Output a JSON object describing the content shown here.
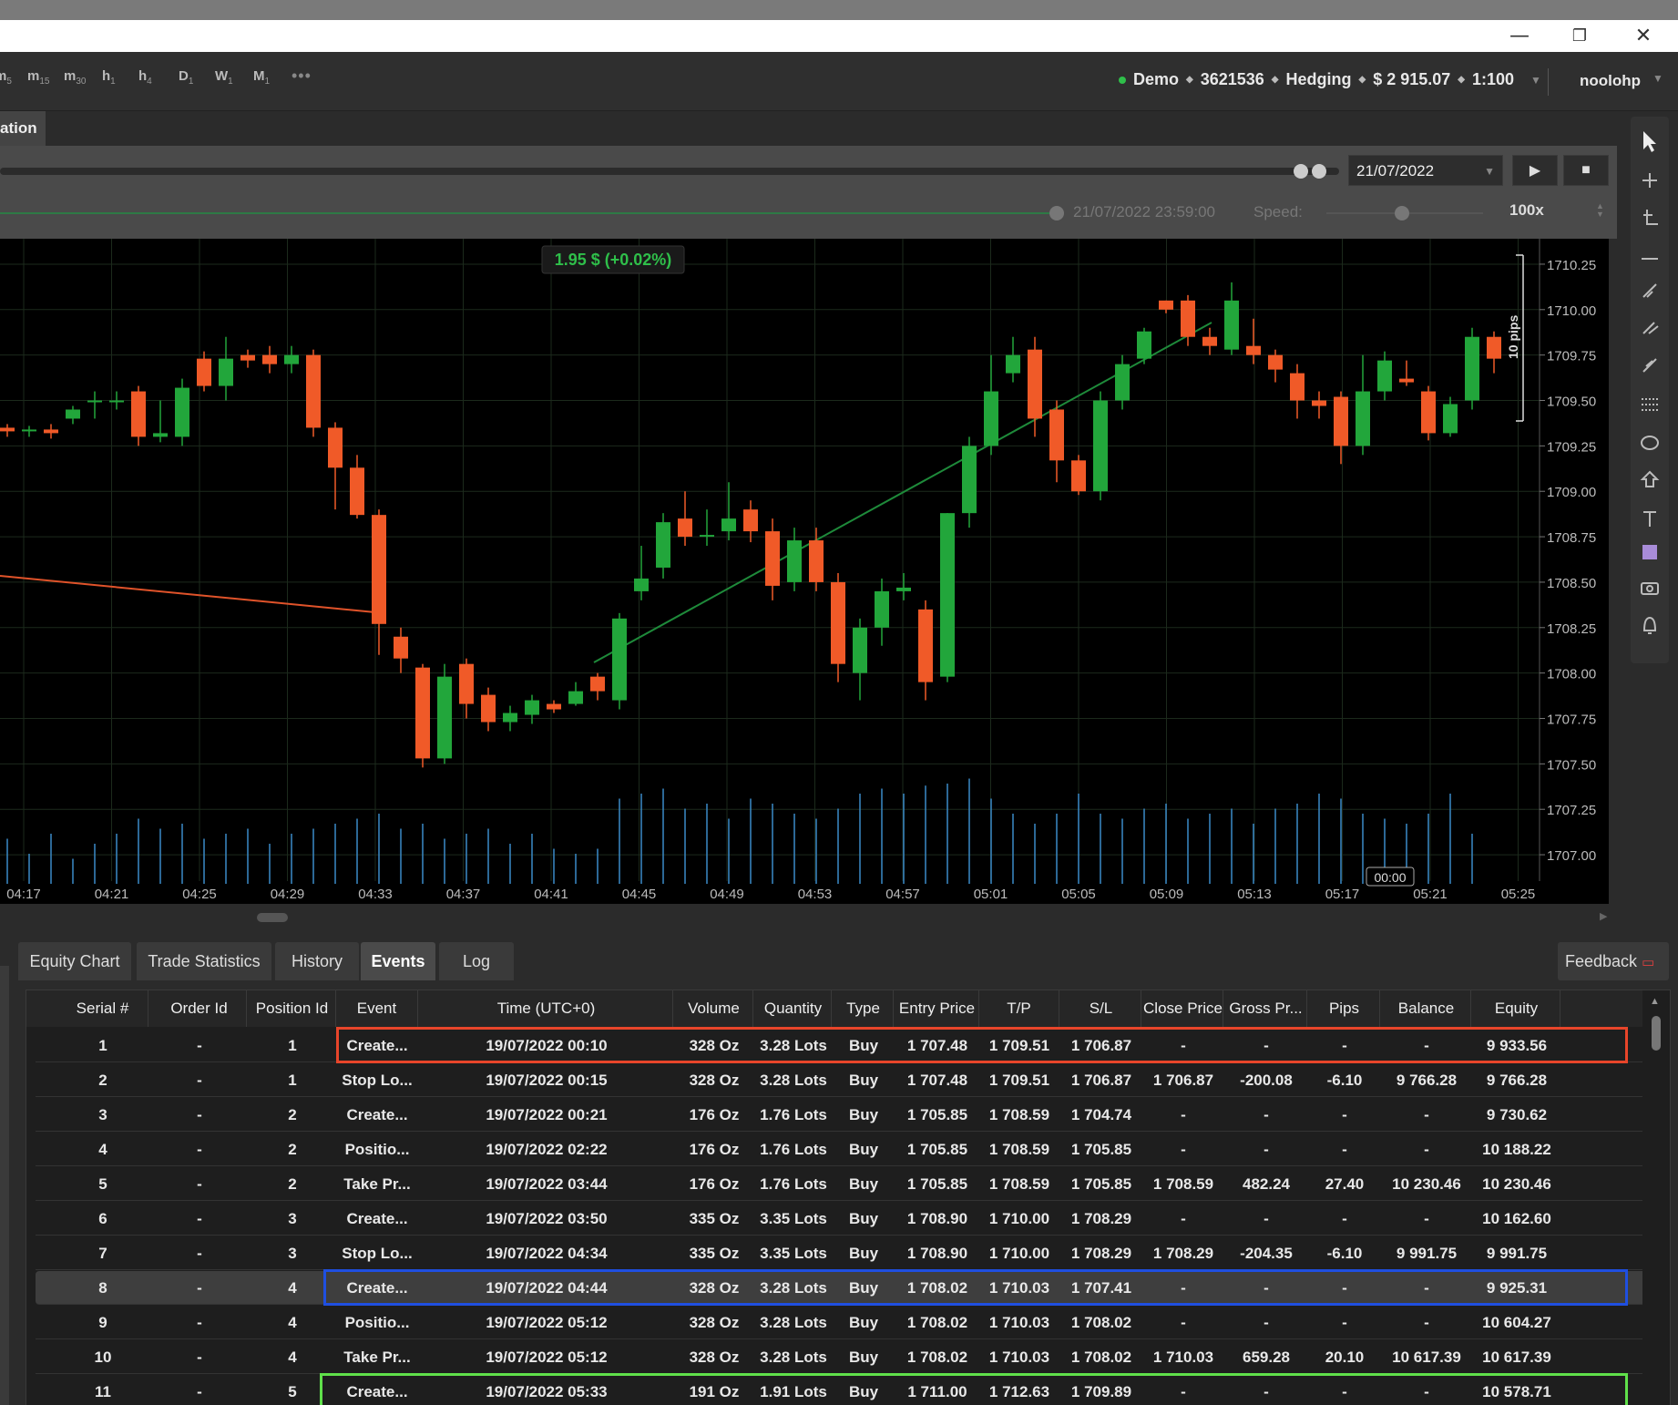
{
  "window": {
    "minimize": "—",
    "restore": "❐",
    "close": "✕"
  },
  "toolbar": {
    "timeframes": [
      {
        "main": "m",
        "sub": "5"
      },
      {
        "main": "m",
        "sub": "15"
      },
      {
        "main": "m",
        "sub": "30"
      },
      {
        "main": "h",
        "sub": "1"
      },
      {
        "main": "h",
        "sub": "4"
      },
      {
        "main": "D",
        "sub": "1"
      },
      {
        "main": "W",
        "sub": "1"
      },
      {
        "main": "M",
        "sub": "1"
      }
    ],
    "more": "•••",
    "account": {
      "mode": "Demo",
      "number": "3621536",
      "type": "Hedging",
      "balance": "$ 2 915.07",
      "leverage": "1:100"
    },
    "user": "noolohp"
  },
  "tab": {
    "label": "ation"
  },
  "controls": {
    "date": "21/07/2022",
    "end_date": "21/07/2022 23:59:00",
    "speed_label": "Speed:",
    "speed_value": "100x",
    "play": "▶",
    "stop": "■"
  },
  "chart_data": {
    "type": "candlestick",
    "pnl_label": "1.95 $ (+0.02%)",
    "measure_label": "10 pips",
    "time_marker": "00:00",
    "y_ticks": [
      "1710.25",
      "1710.00",
      "1709.75",
      "1709.50",
      "1709.25",
      "1709.00",
      "1708.75",
      "1708.50",
      "1708.25",
      "1708.00",
      "1707.75",
      "1707.50",
      "1707.25",
      "1707.00"
    ],
    "x_ticks": [
      "04:17",
      "04:21",
      "04:25",
      "04:29",
      "04:33",
      "04:37",
      "04:41",
      "04:45",
      "04:49",
      "04:53",
      "04:57",
      "05:01",
      "05:05",
      "05:09",
      "05:13",
      "05:17",
      "05:21",
      "05:25"
    ],
    "ylim": [
      1706.88,
      1710.35
    ],
    "up_color": "#22a63b",
    "down_color": "#f05a28",
    "candles": [
      [
        1709.35,
        1709.33,
        1709.3,
        1709.37
      ],
      [
        1709.33,
        1709.34,
        1709.3,
        1709.36
      ],
      [
        1709.34,
        1709.32,
        1709.29,
        1709.37
      ],
      [
        1709.4,
        1709.45,
        1709.37,
        1709.47
      ],
      [
        1709.5,
        1709.5,
        1709.4,
        1709.55
      ],
      [
        1709.5,
        1709.5,
        1709.45,
        1709.55
      ],
      [
        1709.55,
        1709.3,
        1709.25,
        1709.58
      ],
      [
        1709.3,
        1709.32,
        1709.27,
        1709.5
      ],
      [
        1709.3,
        1709.57,
        1709.25,
        1709.62
      ],
      [
        1709.73,
        1709.58,
        1709.55,
        1709.77
      ],
      [
        1709.58,
        1709.73,
        1709.5,
        1709.85
      ],
      [
        1709.75,
        1709.72,
        1709.68,
        1709.78
      ],
      [
        1709.75,
        1709.7,
        1709.65,
        1709.8
      ],
      [
        1709.7,
        1709.75,
        1709.65,
        1709.8
      ],
      [
        1709.75,
        1709.35,
        1709.3,
        1709.78
      ],
      [
        1709.35,
        1709.13,
        1708.9,
        1709.38
      ],
      [
        1709.13,
        1708.87,
        1708.85,
        1709.2
      ],
      [
        1708.87,
        1708.27,
        1708.1,
        1708.9
      ],
      [
        1708.2,
        1708.08,
        1708.0,
        1708.25
      ],
      [
        1708.03,
        1707.53,
        1707.48,
        1708.05
      ],
      [
        1707.53,
        1707.98,
        1707.5,
        1708.05
      ],
      [
        1708.05,
        1707.83,
        1707.75,
        1708.08
      ],
      [
        1707.88,
        1707.73,
        1707.68,
        1707.92
      ],
      [
        1707.73,
        1707.78,
        1707.68,
        1707.82
      ],
      [
        1707.77,
        1707.85,
        1707.72,
        1707.88
      ],
      [
        1707.83,
        1707.8,
        1707.78,
        1707.85
      ],
      [
        1707.83,
        1707.9,
        1707.82,
        1707.95
      ],
      [
        1707.98,
        1707.9,
        1707.85,
        1708.0
      ],
      [
        1707.85,
        1708.3,
        1707.8,
        1708.33
      ],
      [
        1708.45,
        1708.52,
        1708.4,
        1708.7
      ],
      [
        1708.58,
        1708.83,
        1708.52,
        1708.88
      ],
      [
        1708.85,
        1708.75,
        1708.7,
        1709.0
      ],
      [
        1708.75,
        1708.76,
        1708.7,
        1708.9
      ],
      [
        1708.78,
        1708.85,
        1708.73,
        1709.05
      ],
      [
        1708.9,
        1708.78,
        1708.72,
        1708.95
      ],
      [
        1708.78,
        1708.48,
        1708.4,
        1708.85
      ],
      [
        1708.5,
        1708.73,
        1708.45,
        1708.8
      ],
      [
        1708.73,
        1708.5,
        1708.45,
        1708.8
      ],
      [
        1708.5,
        1708.05,
        1707.95,
        1708.55
      ],
      [
        1708.0,
        1708.25,
        1707.85,
        1708.3
      ],
      [
        1708.25,
        1708.45,
        1708.15,
        1708.52
      ],
      [
        1708.45,
        1708.47,
        1708.4,
        1708.55
      ],
      [
        1708.35,
        1707.95,
        1707.85,
        1708.4
      ],
      [
        1707.98,
        1708.88,
        1707.95,
        1708.88
      ],
      [
        1708.88,
        1709.25,
        1708.8,
        1709.3
      ],
      [
        1709.25,
        1709.55,
        1709.2,
        1709.75
      ],
      [
        1709.65,
        1709.75,
        1709.6,
        1709.85
      ],
      [
        1709.78,
        1709.4,
        1709.3,
        1709.85
      ],
      [
        1709.45,
        1709.17,
        1709.05,
        1709.5
      ],
      [
        1709.17,
        1709.0,
        1708.98,
        1709.2
      ],
      [
        1709.0,
        1709.5,
        1708.95,
        1709.55
      ],
      [
        1709.5,
        1709.7,
        1709.45,
        1709.75
      ],
      [
        1709.73,
        1709.88,
        1709.7,
        1709.9
      ],
      [
        1710.05,
        1710.0,
        1709.98,
        1710.05
      ],
      [
        1710.05,
        1709.85,
        1709.8,
        1710.08
      ],
      [
        1709.85,
        1709.8,
        1709.75,
        1709.9
      ],
      [
        1709.78,
        1710.05,
        1709.75,
        1710.15
      ],
      [
        1709.8,
        1709.75,
        1709.7,
        1709.95
      ],
      [
        1709.75,
        1709.67,
        1709.6,
        1709.78
      ],
      [
        1709.65,
        1709.5,
        1709.4,
        1709.7
      ],
      [
        1709.5,
        1709.47,
        1709.4,
        1709.55
      ],
      [
        1709.52,
        1709.25,
        1709.15,
        1709.55
      ],
      [
        1709.25,
        1709.55,
        1709.2,
        1709.75
      ],
      [
        1709.55,
        1709.72,
        1709.5,
        1709.77
      ],
      [
        1709.62,
        1709.6,
        1709.58,
        1709.72
      ],
      [
        1709.55,
        1709.32,
        1709.28,
        1709.58
      ],
      [
        1709.32,
        1709.48,
        1709.3,
        1709.52
      ],
      [
        1709.5,
        1709.85,
        1709.45,
        1709.9
      ],
      [
        1709.85,
        1709.73,
        1709.65,
        1709.88
      ]
    ],
    "volumes": [
      0.45,
      0.3,
      0.5,
      0.25,
      0.4,
      0.5,
      0.65,
      0.55,
      0.6,
      0.45,
      0.5,
      0.55,
      0.4,
      0.5,
      0.55,
      0.6,
      0.65,
      0.7,
      0.55,
      0.6,
      0.45,
      0.5,
      0.55,
      0.4,
      0.5,
      0.35,
      0.3,
      0.35,
      0.85,
      0.9,
      0.95,
      0.75,
      0.8,
      0.65,
      0.85,
      0.8,
      0.7,
      0.65,
      0.75,
      0.9,
      0.95,
      0.9,
      0.98,
      1.0,
      1.05,
      0.85,
      0.7,
      0.6,
      0.7,
      0.9,
      0.7,
      0.65,
      0.75,
      0.8,
      0.65,
      0.7,
      0.75,
      0.6,
      0.75,
      0.8,
      0.9,
      0.85,
      0.7,
      0.65,
      0.6,
      0.7,
      0.9,
      0.5
    ]
  },
  "bottom_tabs": [
    {
      "label": "Equity Chart"
    },
    {
      "label": "Trade Statistics"
    },
    {
      "label": "History"
    },
    {
      "label": "Events"
    },
    {
      "label": "Log"
    }
  ],
  "feedback": "Feedback",
  "table": {
    "columns": [
      "Serial #",
      "Order Id",
      "Position Id",
      "Event",
      "Time (UTC+0)",
      "Volume",
      "Quantity",
      "Type",
      "Entry Price",
      "T/P",
      "S/L",
      "Close Price",
      "Gross Pr...",
      "Pips",
      "Balance",
      "Equity"
    ],
    "rows": [
      [
        "1",
        "-",
        "1",
        "Create...",
        "19/07/2022 00:10",
        "328 Oz",
        "3.28 Lots",
        "Buy",
        "1 707.48",
        "1 709.51",
        "1 706.87",
        "-",
        "-",
        "-",
        "-",
        "9 933.56"
      ],
      [
        "2",
        "-",
        "1",
        "Stop Lo...",
        "19/07/2022 00:15",
        "328 Oz",
        "3.28 Lots",
        "Buy",
        "1 707.48",
        "1 709.51",
        "1 706.87",
        "1 706.87",
        "-200.08",
        "-6.10",
        "9 766.28",
        "9 766.28"
      ],
      [
        "3",
        "-",
        "2",
        "Create...",
        "19/07/2022 00:21",
        "176 Oz",
        "1.76 Lots",
        "Buy",
        "1 705.85",
        "1 708.59",
        "1 704.74",
        "-",
        "-",
        "-",
        "-",
        "9 730.62"
      ],
      [
        "4",
        "-",
        "2",
        "Positio...",
        "19/07/2022 02:22",
        "176 Oz",
        "1.76 Lots",
        "Buy",
        "1 705.85",
        "1 708.59",
        "1 705.85",
        "-",
        "-",
        "-",
        "-",
        "10 188.22"
      ],
      [
        "5",
        "-",
        "2",
        "Take Pr...",
        "19/07/2022 03:44",
        "176 Oz",
        "1.76 Lots",
        "Buy",
        "1 705.85",
        "1 708.59",
        "1 705.85",
        "1 708.59",
        "482.24",
        "27.40",
        "10 230.46",
        "10 230.46"
      ],
      [
        "6",
        "-",
        "3",
        "Create...",
        "19/07/2022 03:50",
        "335 Oz",
        "3.35 Lots",
        "Buy",
        "1 708.90",
        "1 710.00",
        "1 708.29",
        "-",
        "-",
        "-",
        "-",
        "10 162.60"
      ],
      [
        "7",
        "-",
        "3",
        "Stop Lo...",
        "19/07/2022 04:34",
        "335 Oz",
        "3.35 Lots",
        "Buy",
        "1 708.90",
        "1 710.00",
        "1 708.29",
        "1 708.29",
        "-204.35",
        "-6.10",
        "9 991.75",
        "9 991.75"
      ],
      [
        "8",
        "-",
        "4",
        "Create...",
        "19/07/2022 04:44",
        "328 Oz",
        "3.28 Lots",
        "Buy",
        "1 708.02",
        "1 710.03",
        "1 707.41",
        "-",
        "-",
        "-",
        "-",
        "9 925.31"
      ],
      [
        "9",
        "-",
        "4",
        "Positio...",
        "19/07/2022 05:12",
        "328 Oz",
        "3.28 Lots",
        "Buy",
        "1 708.02",
        "1 710.03",
        "1 708.02",
        "-",
        "-",
        "-",
        "-",
        "10 604.27"
      ],
      [
        "10",
        "-",
        "4",
        "Take Pr...",
        "19/07/2022 05:12",
        "328 Oz",
        "3.28 Lots",
        "Buy",
        "1 708.02",
        "1 710.03",
        "1 708.02",
        "1 710.03",
        "659.28",
        "20.10",
        "10 617.39",
        "10 617.39"
      ],
      [
        "11",
        "-",
        "5",
        "Create...",
        "19/07/2022 05:33",
        "191 Oz",
        "1.91 Lots",
        "Buy",
        "1 711.00",
        "1 712.63",
        "1 709.89",
        "-",
        "-",
        "-",
        "-",
        "10 578.71"
      ]
    ],
    "selected_row": 8,
    "highlights": [
      {
        "row": 1,
        "color": "#e8452a"
      },
      {
        "row": 8,
        "color": "#1f4fe0"
      },
      {
        "row": 11,
        "color": "#5fe04a"
      }
    ]
  }
}
